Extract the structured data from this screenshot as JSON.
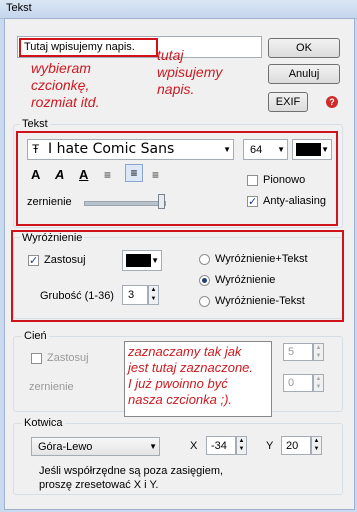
{
  "window": {
    "title": "Tekst"
  },
  "text_input": {
    "value": "Tutaj wpisujemy napis."
  },
  "buttons": {
    "ok": "OK",
    "cancel": "Anuluj",
    "exif": "EXIF"
  },
  "annotations": {
    "top_right": "tutaj\nwpisujemy\nnapis.",
    "top_left": "wybieram\nczcionkę,\nrozmiat itd.",
    "middle": "zaznaczamy tak jak\njest tutaj zaznaczone.\nI już pwoinno być\nnasza czcionka ;)."
  },
  "text_group": {
    "label": "Tekst",
    "font": "I hate Comic Sans",
    "font_prefix": "Ŧ",
    "size": "64",
    "color": "#000000",
    "style_buttons": [
      "A",
      "A",
      "A"
    ],
    "vertical_label": "Pionowo",
    "antialias_label": "Anty-aliasing",
    "antialias_checked": true,
    "vertical_checked": false,
    "fade_label": "zernienie"
  },
  "highlight": {
    "label": "Wyróżnienie",
    "apply_label": "Zastosuj",
    "apply_checked": true,
    "color": "#000000",
    "thickness_label": "Grubość (1-36)",
    "thickness": "3",
    "options": [
      "Wyróżnienie+Tekst",
      "Wyróżnienie",
      "Wyróżnienie-Tekst"
    ],
    "selected": 1
  },
  "shadow": {
    "label": "Cień",
    "apply_label": "Zastosuj",
    "apply_checked": false,
    "fade_label": "zernienie",
    "value1": "5",
    "value2": "0"
  },
  "anchor": {
    "label": "Kotwica",
    "value": "Góra-Lewo",
    "x_label": "X",
    "x": "-34",
    "y_label": "Y",
    "y": "20",
    "note": "Jeśli współrzędne są poza zasięgiem,\nproszę zresetować X i Y."
  }
}
